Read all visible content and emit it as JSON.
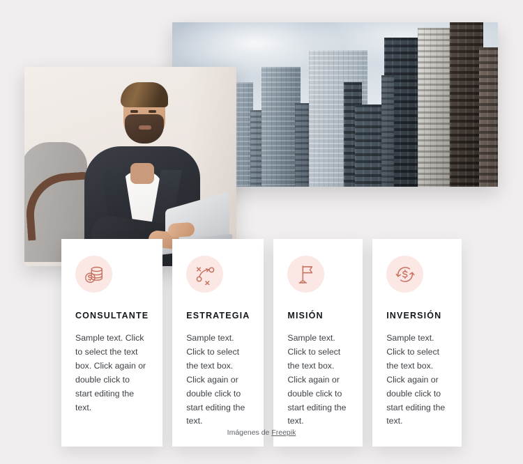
{
  "page": {
    "background_color": "#f0eeee",
    "accent_color": "#c8715f",
    "icon_bg_color": "#fbe8e4"
  },
  "media": {
    "city_photo": {
      "alt": "city-skyscrapers-photo"
    },
    "person_photo": {
      "alt": "businessman-working-on-laptop-photo"
    }
  },
  "cards": [
    {
      "icon": "coins-stack-dollar-icon",
      "title": "CONSULTANTE",
      "body": "Sample text. Click to select the text box. Click again or double click to start editing the text."
    },
    {
      "icon": "strategy-playbook-icon",
      "title": "ESTRATEGIA",
      "body": "Sample text. Click to select the text box. Click again or double click to start editing the text."
    },
    {
      "icon": "flag-icon",
      "title": "MISIÓN",
      "body": "Sample text. Click to select the text box. Click again or double click to start editing the text."
    },
    {
      "icon": "dollar-refresh-cycle-icon",
      "title": "INVERSIÓN",
      "body": "Sample text. Click to select the text box. Click again or double click to start editing the text."
    }
  ],
  "footer": {
    "prefix": "Imágenes de ",
    "link_label": "Freepik"
  }
}
